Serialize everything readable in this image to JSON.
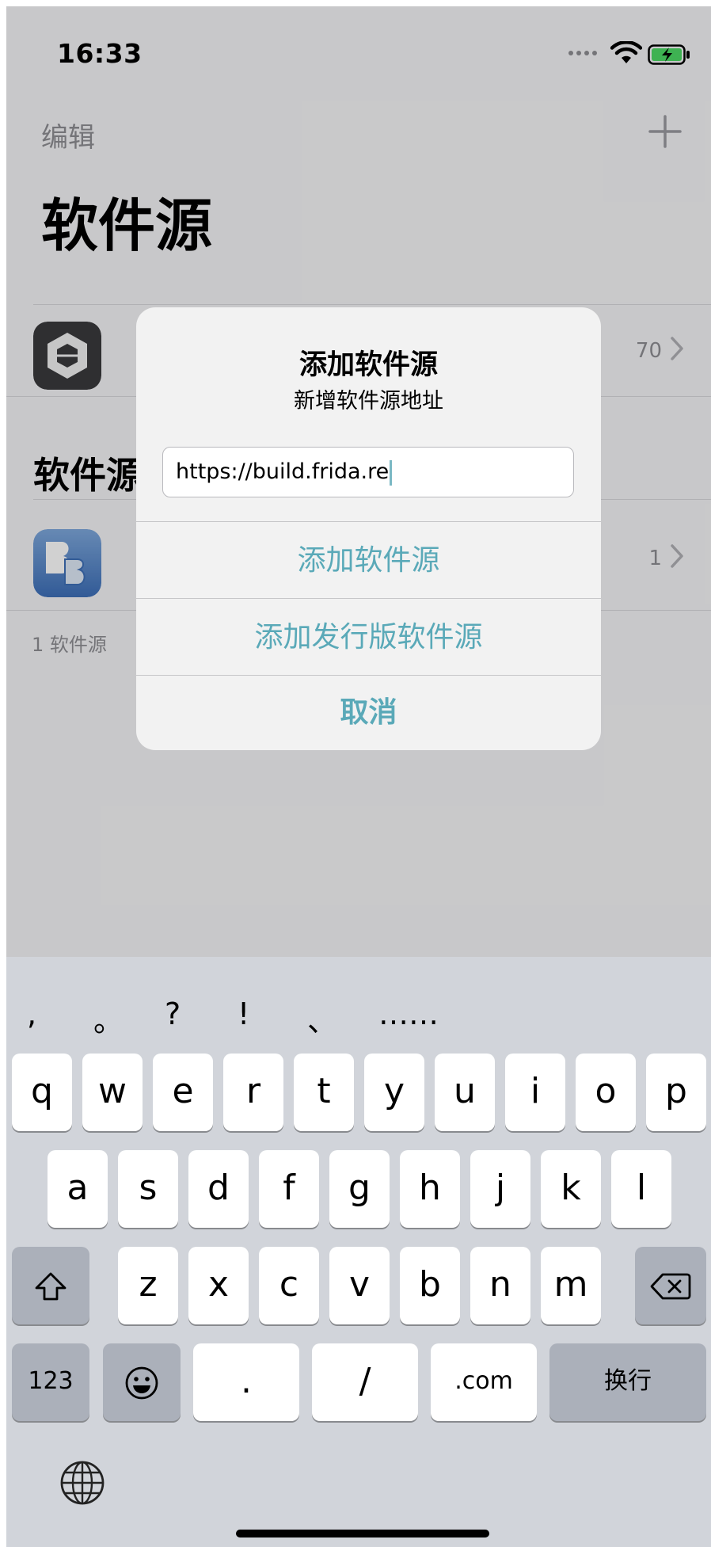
{
  "status_bar": {
    "time": "16:33"
  },
  "nav": {
    "edit_label": "编辑",
    "title": "软件源"
  },
  "repos": [
    {
      "icon": "repo-box-icon",
      "count": "70"
    }
  ],
  "sections": [
    {
      "header": "软件源",
      "items": [
        {
          "icon": "bb-repo-icon",
          "count": "1"
        }
      ],
      "footer": "1 软件源"
    }
  ],
  "alert": {
    "title": "添加软件源",
    "message": "新增软件源地址",
    "input_value": "https://build.frida.re",
    "buttons": {
      "add": "添加软件源",
      "add_distribution": "添加发行版软件源",
      "cancel": "取消"
    }
  },
  "keyboard": {
    "punctuation": [
      ",",
      "。",
      "?",
      "!",
      "、",
      "……"
    ],
    "row1": [
      "q",
      "w",
      "e",
      "r",
      "t",
      "y",
      "u",
      "i",
      "o",
      "p"
    ],
    "row2": [
      "a",
      "s",
      "d",
      "f",
      "g",
      "h",
      "j",
      "k",
      "l"
    ],
    "row3": [
      "z",
      "x",
      "c",
      "v",
      "b",
      "n",
      "m"
    ],
    "numbers_label": "123",
    "dot_label": ".",
    "slash_label": "/",
    "dotcom_label": ".com",
    "return_label": "换行"
  },
  "colors": {
    "accent": "#5aa9b8",
    "keyboard_bg": "#d1d4da"
  }
}
